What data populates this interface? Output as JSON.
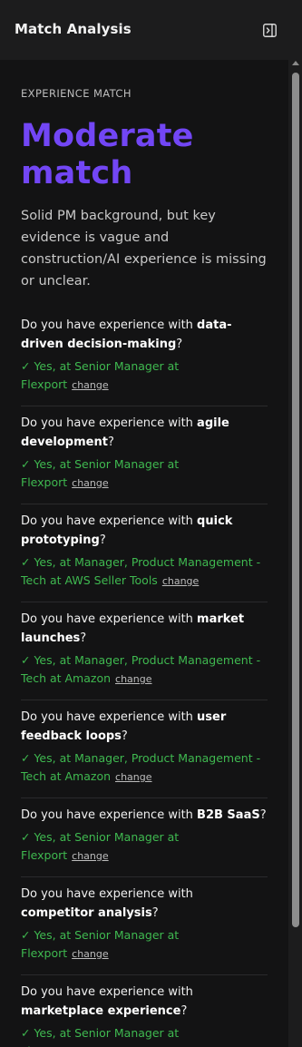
{
  "header": {
    "title": "Match Analysis",
    "collapse_icon": "sidebar-collapse-icon"
  },
  "match": {
    "kicker": "EXPERIENCE MATCH",
    "verdict_line1": "Moderate",
    "verdict_line2": "match",
    "verdict_color": "#7246f5",
    "summary": "Solid PM background, but key evidence is vague and construction/AI experience is missing or unclear."
  },
  "colors": {
    "answer_green": "#3fb950"
  },
  "questions": [
    {
      "prefix": "Do you have experience with ",
      "skill": "data-driven decision-making",
      "suffix": "?",
      "answer": "✓ Yes, at Senior Manager at Flexport",
      "change": "change"
    },
    {
      "prefix": "Do you have experience with ",
      "skill": "agile development",
      "suffix": "?",
      "answer": "✓ Yes, at Senior Manager at Flexport",
      "change": "change"
    },
    {
      "prefix": "Do you have experience with ",
      "skill": "quick prototyping",
      "suffix": "?",
      "answer": "✓ Yes, at Manager, Product Management - Tech at AWS Seller Tools",
      "change": "change"
    },
    {
      "prefix": "Do you have experience with ",
      "skill": "market launches",
      "suffix": "?",
      "answer": "✓ Yes, at Manager, Product Management - Tech at Amazon",
      "change": "change"
    },
    {
      "prefix": "Do you have experience with ",
      "skill": "user feedback loops",
      "suffix": "?",
      "answer": "✓ Yes, at Manager, Product Management - Tech at Amazon",
      "change": "change"
    },
    {
      "prefix": "Do you have experience with ",
      "skill": "B2B SaaS",
      "suffix": "?",
      "answer": "✓ Yes, at Senior Manager at Flexport",
      "change": "change"
    },
    {
      "prefix": "Do you have experience with ",
      "skill": "competitor analysis",
      "suffix": "?",
      "answer": "✓ Yes, at Senior Manager at Flexport",
      "change": "change"
    },
    {
      "prefix": "Do you have experience with ",
      "skill": "marketplace experience",
      "suffix": "?",
      "answer": "✓ Yes, at Senior Manager at Flexport",
      "change": "change"
    }
  ]
}
